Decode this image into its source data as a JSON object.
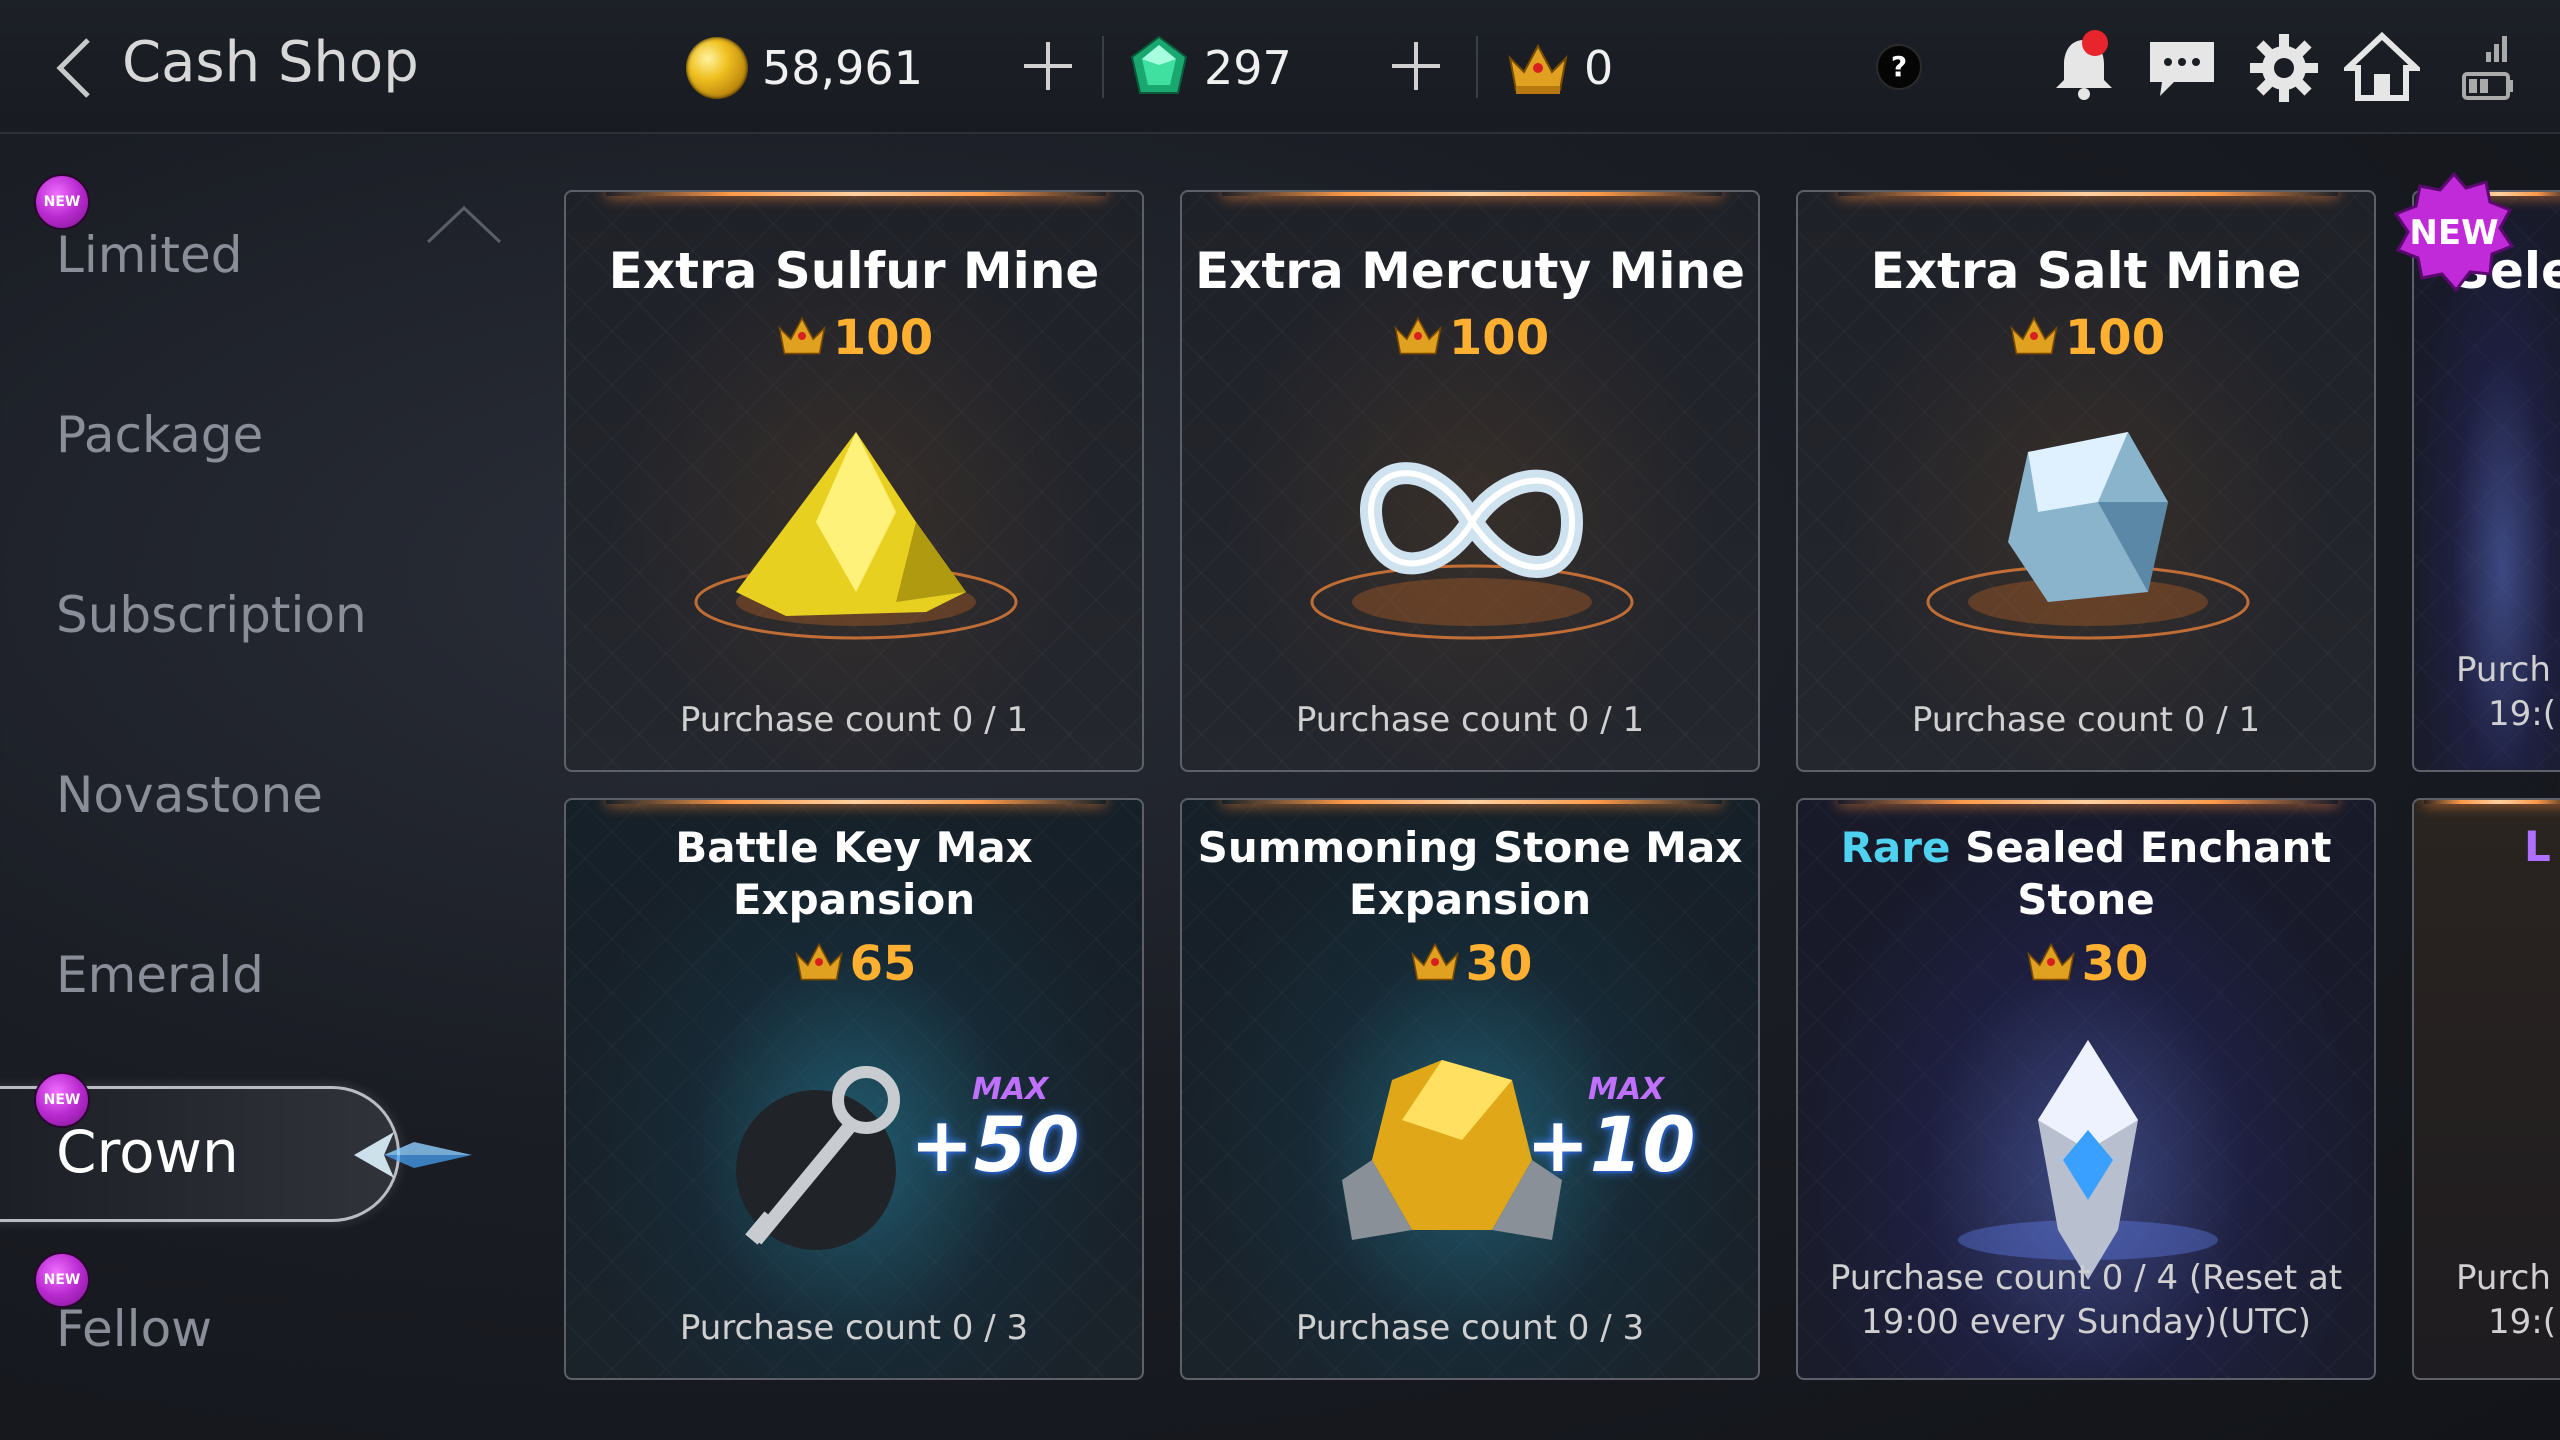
{
  "header": {
    "title": "Cash Shop",
    "gold": "58,961",
    "emerald": "297",
    "crown": "0",
    "help": "?"
  },
  "sidebar": {
    "items": [
      {
        "label": "Limited",
        "new": true
      },
      {
        "label": "Package",
        "new": false
      },
      {
        "label": "Subscription",
        "new": false
      },
      {
        "label": "Novastone",
        "new": false
      },
      {
        "label": "Emerald",
        "new": false
      },
      {
        "label": "Crown",
        "new": true,
        "active": true
      },
      {
        "label": "Fellow",
        "new": true
      }
    ],
    "new_badge": "NEW"
  },
  "cards": [
    {
      "title": "Extra Sulfur Mine",
      "price": "100",
      "purchase": "Purchase count 0 / 1"
    },
    {
      "title": "Extra Mercuty Mine",
      "price": "100",
      "purchase": "Purchase count 0 / 1"
    },
    {
      "title": "Extra Salt Mine",
      "price": "100",
      "purchase": "Purchase count 0 / 1"
    },
    {
      "title_line1": "Battle Key Max",
      "title_line2": "Expansion",
      "price": "65",
      "purchase": "Purchase count 0 / 3",
      "max": "MAX",
      "bonus": "+50"
    },
    {
      "title_line1": "Summoning Stone Max",
      "title_line2": "Expansion",
      "price": "30",
      "purchase": "Purchase count 0 / 3",
      "max": "MAX",
      "bonus": "+10"
    },
    {
      "title_rare": "Rare",
      "title_line1": "Sealed Enchant",
      "title_line2": "Stone",
      "price": "30",
      "purchase_line1": "Purchase count 0 / 4 (Reset at",
      "purchase_line2": "19:00 every Sunday)(UTC)"
    }
  ],
  "partial_cards": [
    {
      "title": "Sele",
      "purchase_line1": "Purch",
      "purchase_line2": "19:("
    },
    {
      "title": "L",
      "purchase_line1": "Purch",
      "purchase_line2": "19:("
    }
  ],
  "corner_badge": "NEW",
  "colors": {
    "price": "#ffb030",
    "rare": "#4fd2f0",
    "new_badge": "#b92ad0",
    "notification": "#e8242c"
  }
}
